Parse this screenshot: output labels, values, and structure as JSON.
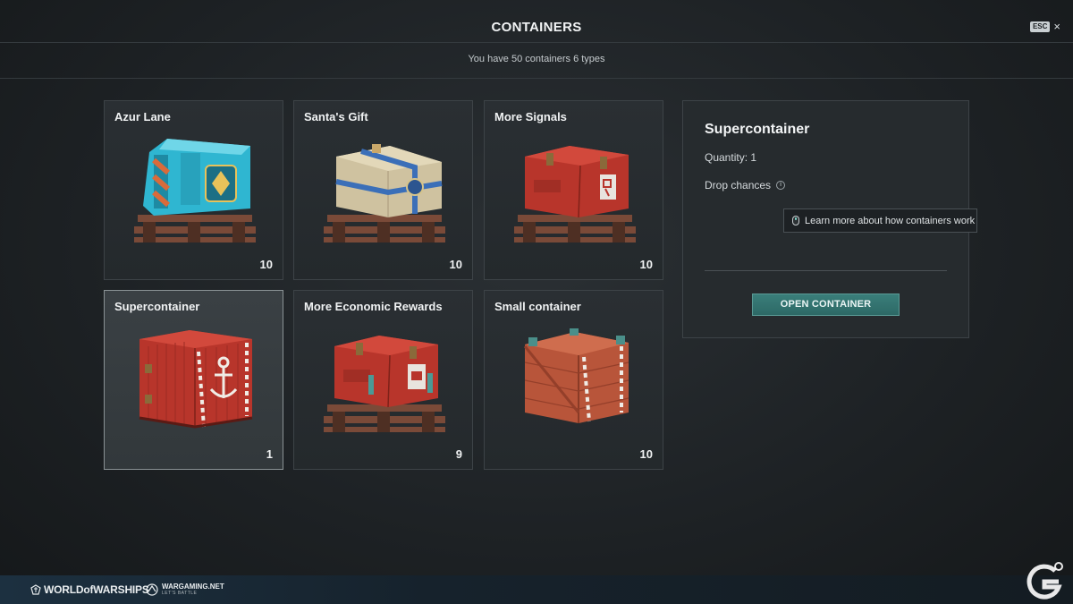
{
  "header": {
    "title": "CONTAINERS",
    "esc_label": "ESC",
    "close_glyph": "×"
  },
  "summary": {
    "text": "You have 50 containers 6 types"
  },
  "containers": [
    {
      "name": "Azur Lane",
      "count": "10",
      "icon": "azur-lane-container-icon",
      "selected": false
    },
    {
      "name": "Santa's Gift",
      "count": "10",
      "icon": "santas-gift-container-icon",
      "selected": false
    },
    {
      "name": "More Signals",
      "count": "10",
      "icon": "more-signals-container-icon",
      "selected": false
    },
    {
      "name": "Supercontainer",
      "count": "1",
      "icon": "supercontainer-icon",
      "selected": true
    },
    {
      "name": "More Economic Rewards",
      "count": "9",
      "icon": "economic-rewards-container-icon",
      "selected": false
    },
    {
      "name": "Small container",
      "count": "10",
      "icon": "small-container-icon",
      "selected": false
    }
  ],
  "details": {
    "title": "Supercontainer",
    "quantity": "Quantity: 1",
    "drop_chances": "Drop chances",
    "tooltip": "Learn more about how containers work",
    "open_button": "OPEN CONTAINER"
  },
  "footer": {
    "game_logo": "WORLDofWARSHIPS",
    "publisher_logo": "WARGAMING.NET",
    "publisher_tagline": "LET'S BATTLE"
  },
  "colors": {
    "accent_teal": "#3a7e7a",
    "crate_red": "#b8352b",
    "azur_cyan": "#2fb6d1",
    "santa_beige": "#cfc2a0",
    "santa_ribbon": "#3b6fb8"
  }
}
